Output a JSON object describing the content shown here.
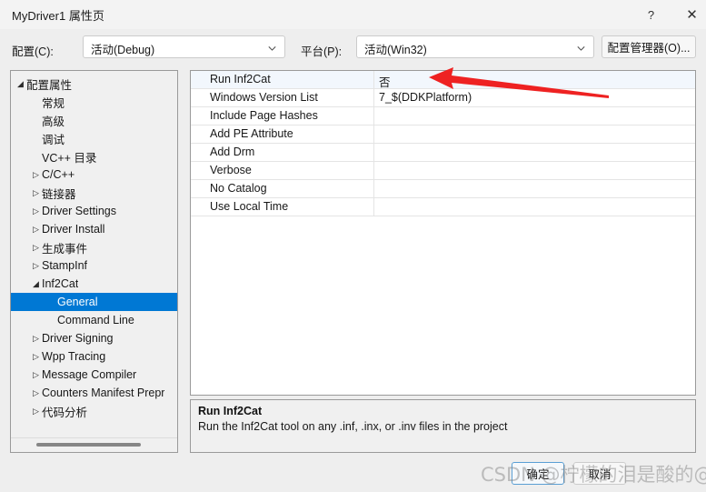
{
  "window": {
    "title": "MyDriver1 属性页",
    "help_icon": "?",
    "close_icon": "✕"
  },
  "config_bar": {
    "config_label": "配置(C):",
    "config_value": "活动(Debug)",
    "platform_label": "平台(P):",
    "platform_value": "活动(Win32)",
    "config_manager_button": "配置管理器(O)..."
  },
  "tree": {
    "items": [
      {
        "label": "配置属性",
        "indent": 0,
        "expander": "expanded",
        "selected": false
      },
      {
        "label": "常规",
        "indent": 1,
        "expander": "none",
        "selected": false
      },
      {
        "label": "高级",
        "indent": 1,
        "expander": "none",
        "selected": false
      },
      {
        "label": "调试",
        "indent": 1,
        "expander": "none",
        "selected": false
      },
      {
        "label": "VC++ 目录",
        "indent": 1,
        "expander": "none",
        "selected": false
      },
      {
        "label": "C/C++",
        "indent": 1,
        "expander": "collapsed",
        "selected": false
      },
      {
        "label": "链接器",
        "indent": 1,
        "expander": "collapsed",
        "selected": false
      },
      {
        "label": "Driver Settings",
        "indent": 1,
        "expander": "collapsed",
        "selected": false
      },
      {
        "label": "Driver Install",
        "indent": 1,
        "expander": "collapsed",
        "selected": false
      },
      {
        "label": "生成事件",
        "indent": 1,
        "expander": "collapsed",
        "selected": false
      },
      {
        "label": "StampInf",
        "indent": 1,
        "expander": "collapsed",
        "selected": false
      },
      {
        "label": "Inf2Cat",
        "indent": 1,
        "expander": "expanded",
        "selected": false
      },
      {
        "label": "General",
        "indent": 2,
        "expander": "none",
        "selected": true
      },
      {
        "label": "Command Line",
        "indent": 2,
        "expander": "none",
        "selected": false
      },
      {
        "label": "Driver Signing",
        "indent": 1,
        "expander": "collapsed",
        "selected": false
      },
      {
        "label": "Wpp Tracing",
        "indent": 1,
        "expander": "collapsed",
        "selected": false
      },
      {
        "label": "Message Compiler",
        "indent": 1,
        "expander": "collapsed",
        "selected": false
      },
      {
        "label": "Counters Manifest Prepr",
        "indent": 1,
        "expander": "collapsed",
        "selected": false
      },
      {
        "label": "代码分析",
        "indent": 1,
        "expander": "collapsed",
        "selected": false
      }
    ],
    "expander_expanded_glyph": "◢",
    "expander_collapsed_glyph": "▷"
  },
  "property_grid": {
    "rows": [
      {
        "name": "Run Inf2Cat",
        "value": "否",
        "selected": true
      },
      {
        "name": "Windows Version List",
        "value": "7_$(DDKPlatform)",
        "selected": false
      },
      {
        "name": "Include Page Hashes",
        "value": "",
        "selected": false
      },
      {
        "name": "Add PE Attribute",
        "value": "",
        "selected": false
      },
      {
        "name": "Add Drm",
        "value": "",
        "selected": false
      },
      {
        "name": "Verbose",
        "value": "",
        "selected": false
      },
      {
        "name": "No Catalog",
        "value": "",
        "selected": false
      },
      {
        "name": "Use Local Time",
        "value": "",
        "selected": false
      }
    ]
  },
  "description": {
    "title": "Run Inf2Cat",
    "body": "Run the Inf2Cat tool on any .inf, .inx, or .inv files in the project"
  },
  "footer": {
    "ok_label": "确定",
    "cancel_label": "取消"
  },
  "annotation": {
    "arrow_color": "#ee2222",
    "arrow_name": "red-arrow-pointing-to-run-inf2cat-value"
  },
  "watermark": {
    "text": "CSDN @柠檬的泪是酸的@"
  }
}
